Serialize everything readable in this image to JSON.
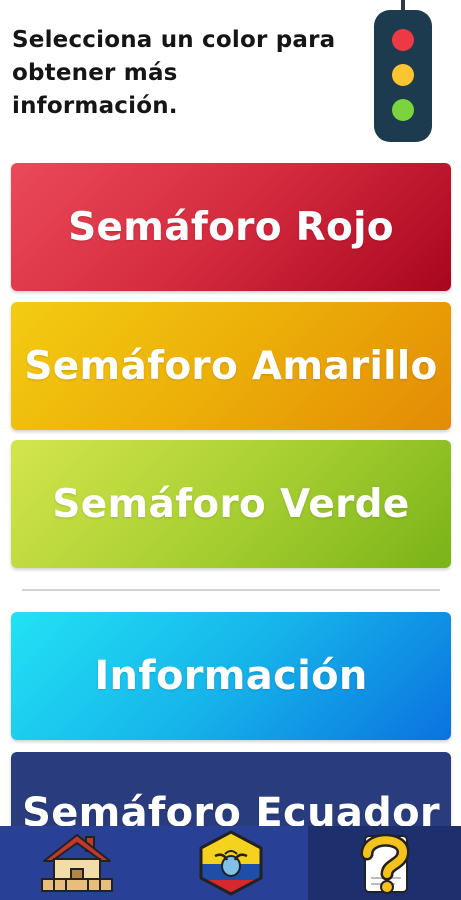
{
  "header": {
    "instruction": "Selecciona un color para obtener más información."
  },
  "buttons": {
    "rojo": "Semáforo Rojo",
    "amarillo": "Semáforo Amarillo",
    "verde": "Semáforo Verde",
    "informacion": "Información",
    "ecuador": "Semáforo Ecuador"
  },
  "icons": {
    "header": "traffic-light-icon",
    "nav": [
      "home-icon",
      "ecuador-flag-icon",
      "help-icon"
    ]
  },
  "colors": {
    "rojo": "#d42a3e",
    "amarillo": "#ecae08",
    "verde": "#a9d033",
    "informacion": "#16b4ea",
    "ecuador": "#293c7e",
    "nav_bar": "#284096"
  }
}
